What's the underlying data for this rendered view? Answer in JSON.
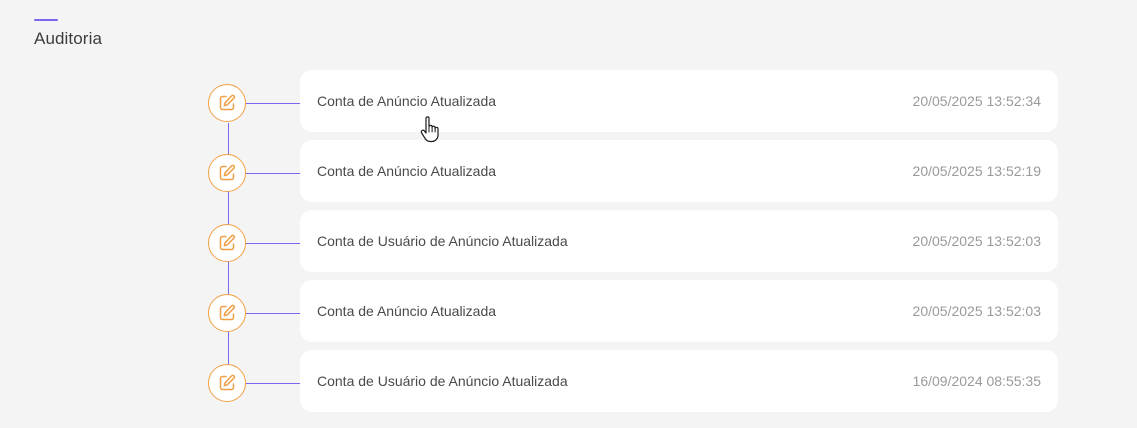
{
  "section": {
    "title": "Auditoria"
  },
  "colors": {
    "accent": "#7b68ee",
    "icon_orange": "#f0a044",
    "card_bg": "#ffffff",
    "page_bg": "#f4f4f4"
  },
  "entries": [
    {
      "icon": "edit-icon",
      "description": "Conta de Anúncio Atualizada",
      "timestamp": "20/05/2025 13:52:34"
    },
    {
      "icon": "edit-icon",
      "description": "Conta de Anúncio Atualizada",
      "timestamp": "20/05/2025 13:52:19"
    },
    {
      "icon": "edit-icon",
      "description": "Conta de Usuário de Anúncio Atualizada",
      "timestamp": "20/05/2025 13:52:03"
    },
    {
      "icon": "edit-icon",
      "description": "Conta de Anúncio Atualizada",
      "timestamp": "20/05/2025 13:52:03"
    },
    {
      "icon": "edit-icon",
      "description": "Conta de Usuário de Anúncio Atualizada",
      "timestamp": "16/09/2024 08:55:35"
    }
  ]
}
